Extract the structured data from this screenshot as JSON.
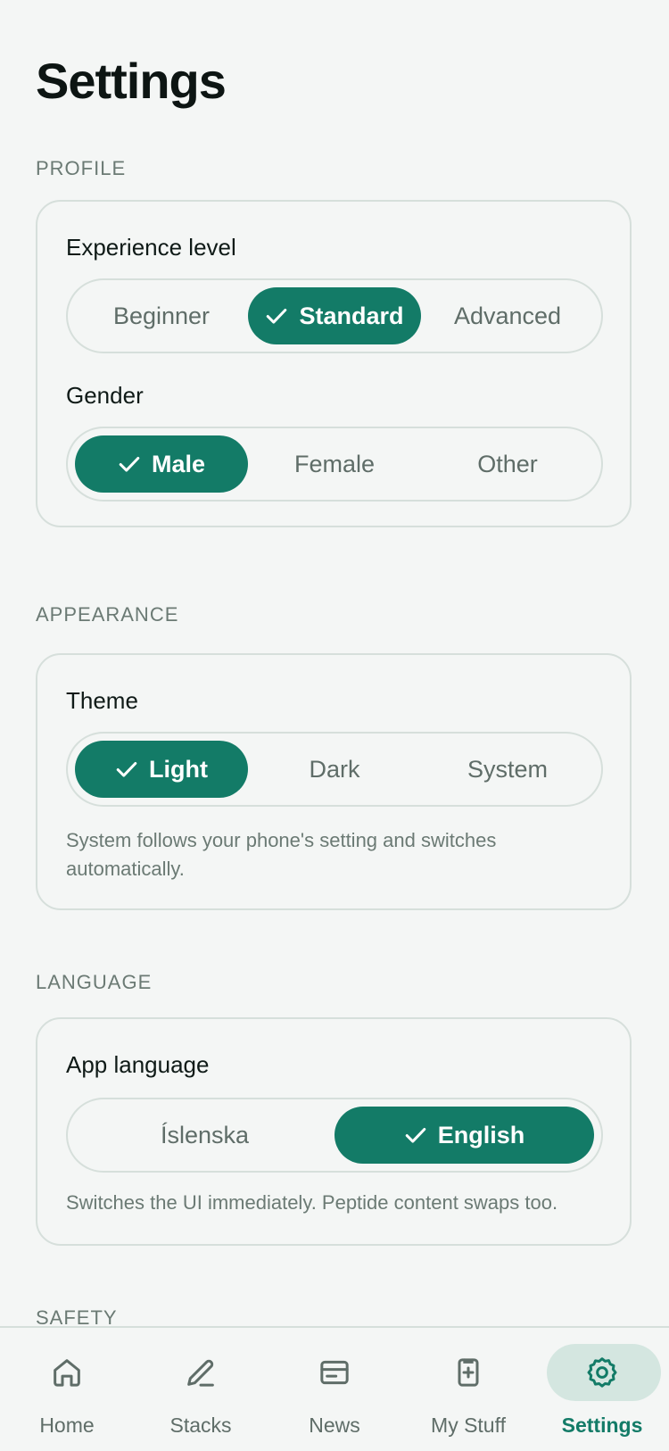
{
  "page": {
    "title": "Settings"
  },
  "sections": {
    "profile": {
      "label": "PROFILE",
      "experience": {
        "label": "Experience level",
        "options": [
          "Beginner",
          "Standard",
          "Advanced"
        ],
        "selected": "Standard"
      },
      "gender": {
        "label": "Gender",
        "options": [
          "Male",
          "Female",
          "Other"
        ],
        "selected": "Male"
      }
    },
    "appearance": {
      "label": "APPEARANCE",
      "theme": {
        "label": "Theme",
        "options": [
          "Light",
          "Dark",
          "System"
        ],
        "selected": "Light",
        "help": "System follows your phone's setting and switches automatically."
      }
    },
    "language": {
      "label": "LANGUAGE",
      "app_language": {
        "label": "App language",
        "options": [
          "Íslenska",
          "English"
        ],
        "selected": "English",
        "help": "Switches the UI immediately. Peptide content swaps too."
      }
    },
    "safety": {
      "label": "SAFETY"
    }
  },
  "nav": {
    "items": [
      {
        "label": "Home",
        "icon": "home-icon"
      },
      {
        "label": "Stacks",
        "icon": "pencil-icon"
      },
      {
        "label": "News",
        "icon": "news-card-icon"
      },
      {
        "label": "My Stuff",
        "icon": "document-plus-icon"
      },
      {
        "label": "Settings",
        "icon": "gear-icon"
      }
    ],
    "active": "Settings"
  },
  "colors": {
    "accent": "#137b67",
    "accent_soft": "#d4e6e0",
    "background": "#f4f6f5",
    "border": "#d6dfdb",
    "muted_text": "#6b7a74"
  }
}
